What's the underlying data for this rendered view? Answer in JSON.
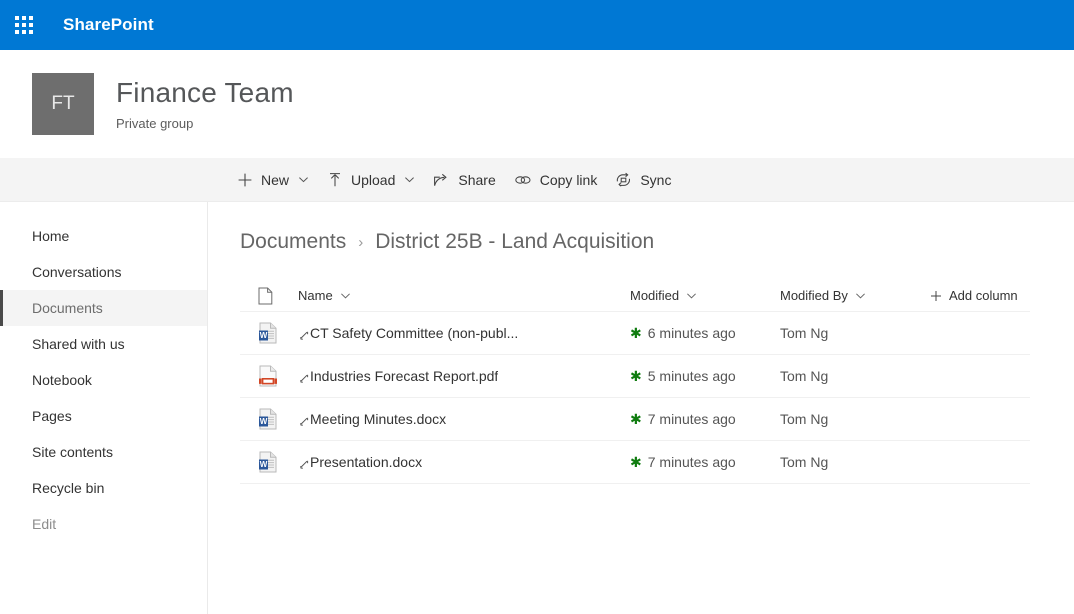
{
  "suite": {
    "waffle_icon": "app-launcher-waffle-icon",
    "brand": "SharePoint"
  },
  "site": {
    "logo_initials": "FT",
    "name": "Finance Team",
    "privacy": "Private group"
  },
  "command_bar": {
    "items": [
      {
        "label": "New",
        "icon": "plus-icon",
        "has_chevron": true
      },
      {
        "label": "Upload",
        "icon": "upload-arrow-icon",
        "has_chevron": true
      },
      {
        "label": "Share",
        "icon": "share-icon",
        "has_chevron": false
      },
      {
        "label": "Copy link",
        "icon": "link-icon",
        "has_chevron": false
      },
      {
        "label": "Sync",
        "icon": "sync-icon",
        "has_chevron": false
      }
    ]
  },
  "sidebar": {
    "items": [
      {
        "label": "Home",
        "selected": false,
        "muted": false
      },
      {
        "label": "Conversations",
        "selected": false,
        "muted": false
      },
      {
        "label": "Documents",
        "selected": true,
        "muted": false
      },
      {
        "label": "Shared with us",
        "selected": false,
        "muted": false
      },
      {
        "label": "Notebook",
        "selected": false,
        "muted": false
      },
      {
        "label": "Pages",
        "selected": false,
        "muted": false
      },
      {
        "label": "Site contents",
        "selected": false,
        "muted": false
      },
      {
        "label": "Recycle bin",
        "selected": false,
        "muted": false
      },
      {
        "label": "Edit",
        "selected": false,
        "muted": true
      }
    ]
  },
  "breadcrumb": {
    "separator": "›",
    "crumbs": [
      "Documents",
      "District 25B - Land Acquisition"
    ]
  },
  "file_list": {
    "columns": {
      "type_icon": "file-type-icon",
      "name": "Name",
      "modified": "Modified",
      "modified_by": "Modified By",
      "add_column": "Add column"
    },
    "rows": [
      {
        "icon": "word-document-icon",
        "name": "CT Safety Committee (non-publ...",
        "modified": "6 minutes ago",
        "modified_by": "Tom Ng",
        "new_indicator": true
      },
      {
        "icon": "pdf-document-icon",
        "name": "Industries Forecast Report.pdf",
        "modified": "5 minutes ago",
        "modified_by": "Tom Ng",
        "new_indicator": true
      },
      {
        "icon": "word-document-icon",
        "name": "Meeting Minutes.docx",
        "modified": "7 minutes ago",
        "modified_by": "Tom Ng",
        "new_indicator": true
      },
      {
        "icon": "word-document-icon",
        "name": "Presentation.docx",
        "modified": "7 minutes ago",
        "modified_by": "Tom Ng",
        "new_indicator": true
      }
    ]
  },
  "colors": {
    "suite_bar": "#0078d4",
    "site_logo": "#6e6e6e",
    "command_bar": "#f4f4f4",
    "word_blue": "#2b579a",
    "pdf_red": "#d24726",
    "new_green": "#107c10"
  }
}
